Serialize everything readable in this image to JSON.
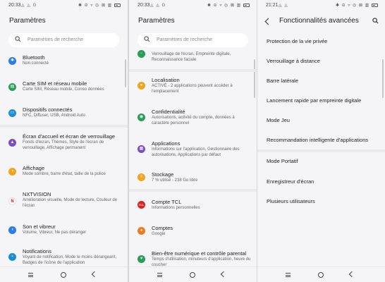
{
  "screen1": {
    "status": {
      "time": "20:33",
      "left_icons": "◬ ◬ G"
    },
    "title": "Paramètres",
    "search_placeholder": "Paramètres de recherche",
    "items": [
      {
        "icon": "bluetooth-icon",
        "glyph": "✱",
        "color": "#2b7de9",
        "title": "Bluetooth",
        "sub": "Non connecté"
      },
      {
        "icon": "sim-card-icon",
        "glyph": "▤",
        "color": "#2a9d58",
        "title": "Carte SIM et réseau mobile",
        "sub": "Carte SIM, Réseau mobile, Conso données"
      },
      {
        "icon": "devices-icon",
        "glyph": "▭",
        "color": "#1b8fd6",
        "title": "Dispositifs connectés",
        "sub": "NFC, Diffuser, USB, Android Auto"
      },
      {
        "icon": "wallpaper-icon",
        "glyph": "▲",
        "color": "#7a4fc5",
        "title": "Écran d'accueil et écran de verrouillage",
        "sub": "Fonds d'écran, Thèmes, Style de l'écran de verrouillage, Affichage permanent"
      },
      {
        "icon": "display-icon",
        "glyph": "◑",
        "color": "#f0a51c",
        "title": "Affichage",
        "sub": "Mode sombre, barre d'état, taille de la police"
      },
      {
        "icon": "nxtvision-icon",
        "glyph": "N",
        "color": "#ffffff",
        "title": "NXTVISION",
        "sub": "Amélioration visuelle, Mode de lecture, Couleur de l'écran"
      },
      {
        "icon": "sound-icon",
        "glyph": "◖",
        "color": "#2b7de9",
        "title": "Son et vibreur",
        "sub": "Volume, Vibreur, Ne pas déranger"
      },
      {
        "icon": "notifications-icon",
        "glyph": "▪",
        "color": "#1b8fd6",
        "title": "Notifications",
        "sub": "Voyant de notification, Mode le moins dérangeant, Badges de l'icône de l'application"
      }
    ]
  },
  "screen2": {
    "status": {
      "time": "20:33",
      "left_icons": "◬ ◬ G"
    },
    "title": "Paramètres",
    "search_placeholder": "Paramètres de recherche",
    "partial_sub": "Verrouillage de l'écran, Empreinte digitale, Reconnaissance faciale",
    "items": [
      {
        "icon": "location-icon",
        "glyph": "●",
        "color": "#f0a51c",
        "title": "Localisation",
        "sub": "ACTIVÉ - 2 applications peuvent accéder à l'emplacement"
      },
      {
        "icon": "privacy-icon",
        "glyph": "◉",
        "color": "#2a9d58",
        "title": "Confidentialité",
        "sub": "Autorisations, activité du compte, données à caractère personnel"
      },
      {
        "icon": "apps-icon",
        "glyph": "▦",
        "color": "#7a4fc5",
        "title": "Applications",
        "sub": "Informations sur l'application, Gestionnaire des autorisations, Applications par défaut"
      },
      {
        "icon": "storage-icon",
        "glyph": "≡",
        "color": "#f0a51c",
        "title": "Stockage",
        "sub": "7 % utilisé - 238 Go libre"
      },
      {
        "icon": "tcl-account-icon",
        "glyph": "TCL",
        "color": "#e02020",
        "title": "Compte TCL",
        "sub": "Informations personnelles"
      },
      {
        "icon": "accounts-icon",
        "glyph": "●",
        "color": "#f07a1c",
        "title": "Comptes",
        "sub": "Google"
      },
      {
        "icon": "wellbeing-icon",
        "glyph": "♥",
        "color": "#2a9d58",
        "title": "Bien-être numérique et contrôle parental",
        "sub": "Temps d'utilisation, minuteurs d'application, heure du coucher"
      }
    ]
  },
  "screen3": {
    "status": {
      "time": "21:21",
      "left_icons": "◬ ◬"
    },
    "title": "Fonctionnalités avancées",
    "options": [
      "Protection de la vie privée",
      "Verrouillage à distance",
      "Barre latérale",
      "Lancement rapide par empreinte digitale",
      "Mode Jeu",
      "Recommandation intelligente d'applications",
      "Mode Portatif",
      "Enregistreur d'écran",
      "Plusieurs utilisateurs"
    ]
  },
  "status_right_icons": "✱ ⊝ ▿ ◎ ⊠ ▥"
}
